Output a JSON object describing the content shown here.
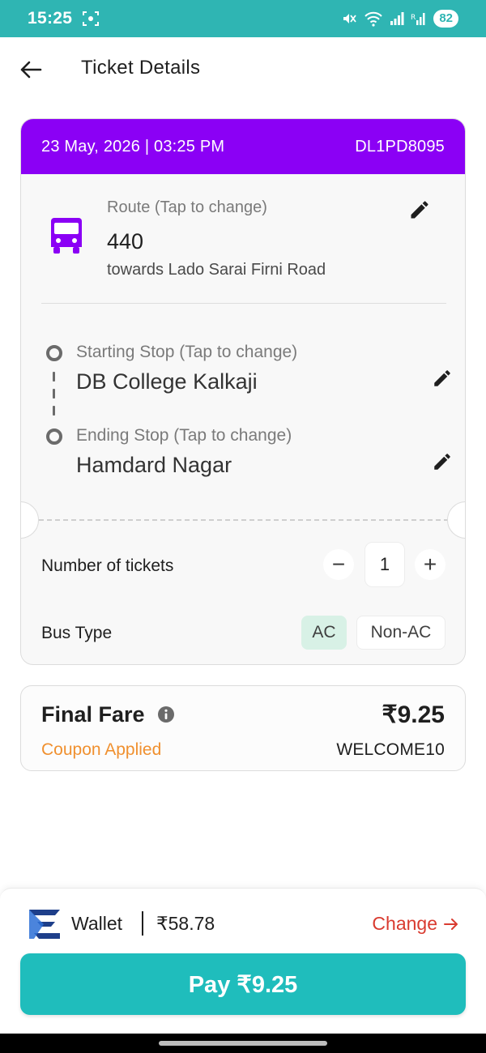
{
  "status_bar": {
    "time": "15:25",
    "battery": "82"
  },
  "header": {
    "title": "Ticket Details"
  },
  "ticket": {
    "datetime": "23 May, 2026 | 03:25 PM",
    "vehicle_number": "DL1PD8095",
    "route_label": "Route (Tap to change)",
    "route_number": "440",
    "route_direction": "towards Lado Sarai Firni Road",
    "start_label": "Starting Stop (Tap to change)",
    "start_stop": "DB College Kalkaji",
    "end_label": "Ending Stop (Tap to change)",
    "end_stop": "Hamdard Nagar",
    "tickets_label": "Number of tickets",
    "ticket_count": "1",
    "decrement": "−",
    "increment": "+",
    "bus_type_label": "Bus Type",
    "bus_type_options": [
      "AC",
      "Non-AC"
    ],
    "selected_bus_type": "AC"
  },
  "fare": {
    "title": "Final Fare",
    "amount": "₹9.25",
    "coupon_label": "Coupon Applied",
    "coupon_code": "WELCOME10"
  },
  "payment": {
    "wallet_label": "Wallet",
    "wallet_balance": "₹58.78",
    "change_label": "Change",
    "pay_label": "Pay ₹9.25"
  },
  "colors": {
    "status_bar": "#2fb5b3",
    "ticket_header": "#8b00f5",
    "bus_icon": "#8b00f5",
    "coupon": "#f0902f",
    "change_link": "#d93b30",
    "pay_button": "#1fbdbc",
    "ac_chip": "#d8f1e6"
  },
  "icons": {
    "back": "arrow-left-icon",
    "bus": "bus-icon",
    "edit": "pencil-icon",
    "info": "info-icon",
    "wallet_logo": "wallet-logo-icon",
    "change_arrow": "arrow-right-icon"
  }
}
